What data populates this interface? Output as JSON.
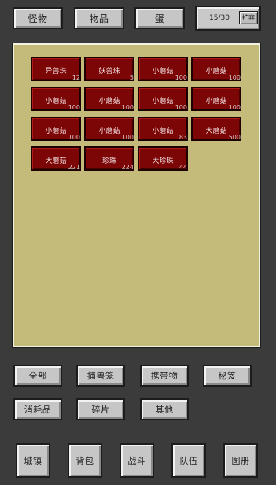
{
  "top_tabs": [
    "怪物",
    "物品",
    "蛋"
  ],
  "capacity": {
    "count": "15/30",
    "expand_label": "扩容"
  },
  "inventory": [
    {
      "name": "异兽珠",
      "qty": "12"
    },
    {
      "name": "妖兽珠",
      "qty": "5"
    },
    {
      "name": "小蘑菇",
      "qty": "100"
    },
    {
      "name": "小蘑菇",
      "qty": "100"
    },
    {
      "name": "小蘑菇",
      "qty": "100"
    },
    {
      "name": "小蘑菇",
      "qty": "100"
    },
    {
      "name": "小蘑菇",
      "qty": "100"
    },
    {
      "name": "小蘑菇",
      "qty": "100"
    },
    {
      "name": "小蘑菇",
      "qty": "100"
    },
    {
      "name": "小蘑菇",
      "qty": "100"
    },
    {
      "name": "小蘑菇",
      "qty": "83"
    },
    {
      "name": "大蘑菇",
      "qty": "500"
    },
    {
      "name": "大蘑菇",
      "qty": "221"
    },
    {
      "name": "珍珠",
      "qty": "224"
    },
    {
      "name": "大珍珠",
      "qty": "44"
    }
  ],
  "filters": [
    "全部",
    "捕兽笼",
    "携带物",
    "秘笈",
    "消耗品",
    "碎片",
    "其他"
  ],
  "bottom_nav": [
    "城镇",
    "背包",
    "战斗",
    "队伍",
    "图册"
  ]
}
